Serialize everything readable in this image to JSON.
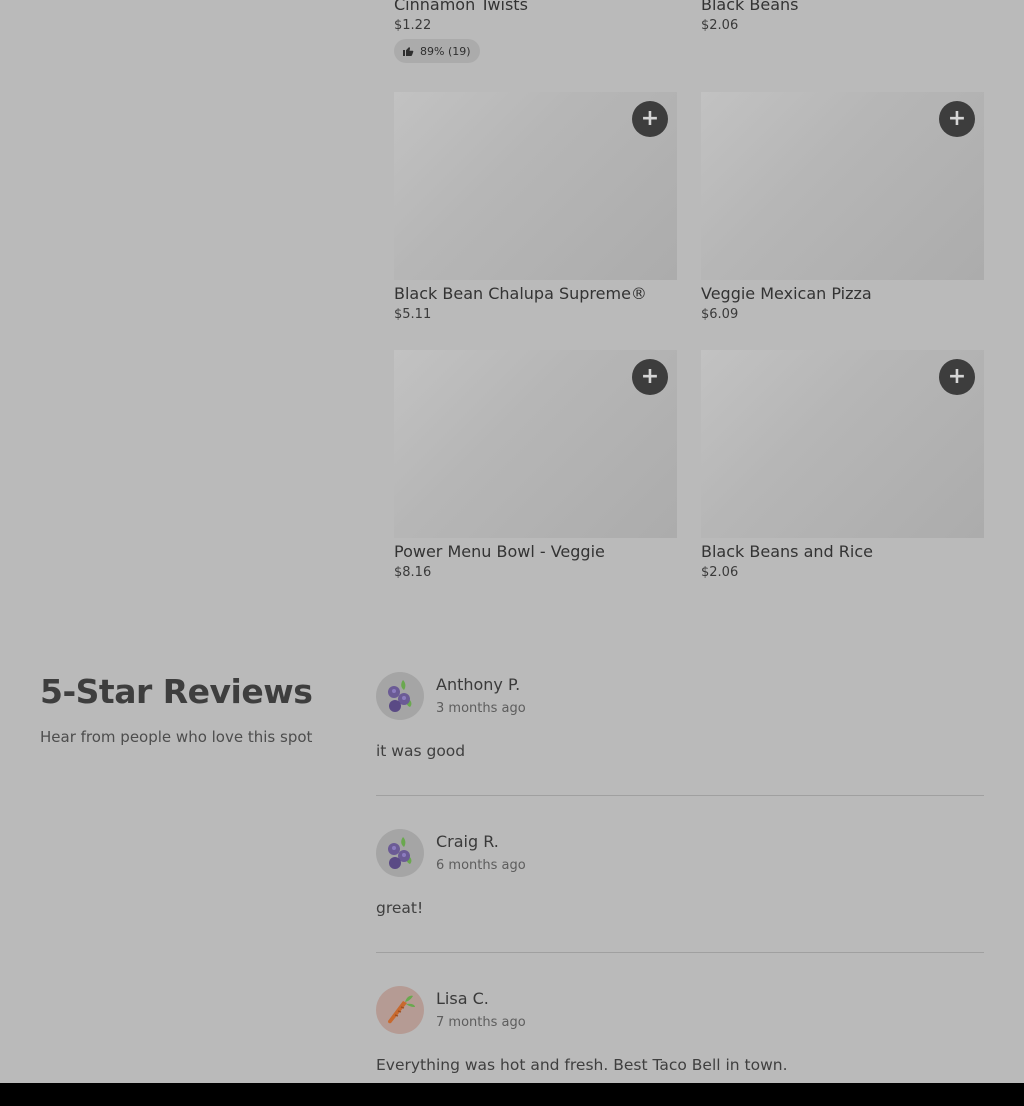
{
  "menu": {
    "top_left": {
      "name": "Cinnamon Twists",
      "price": "$1.22",
      "rating": "89% (19)"
    },
    "top_right": {
      "name": "Black Beans",
      "price": "$2.06"
    },
    "items": [
      {
        "name": "Black Bean Chalupa Supreme®",
        "price": "$5.11",
        "add_label": "+"
      },
      {
        "name": "Veggie Mexican Pizza",
        "price": "$6.09",
        "add_label": "+"
      },
      {
        "name": "Power Menu Bowl - Veggie",
        "price": "$8.16",
        "add_label": "+"
      },
      {
        "name": "Black Beans and Rice",
        "price": "$2.06",
        "add_label": "+"
      }
    ]
  },
  "reviews": {
    "title": "5-Star Reviews",
    "subtitle": "Hear from people who love this spot",
    "list": [
      {
        "name": "Anthony P.",
        "time": "3 months ago",
        "text": "it was good",
        "avatar_icon": "blueberry-icon"
      },
      {
        "name": "Craig R.",
        "time": "6 months ago",
        "text": "great!",
        "avatar_icon": "blueberry-icon"
      },
      {
        "name": "Lisa C.",
        "time": "7 months ago",
        "text": "Everything was hot and fresh. Best Taco Bell in town.",
        "avatar_icon": "carrot-icon"
      }
    ]
  },
  "colors": {
    "overlay_bg": "#bababa",
    "add_button": "#3d3d3d"
  }
}
